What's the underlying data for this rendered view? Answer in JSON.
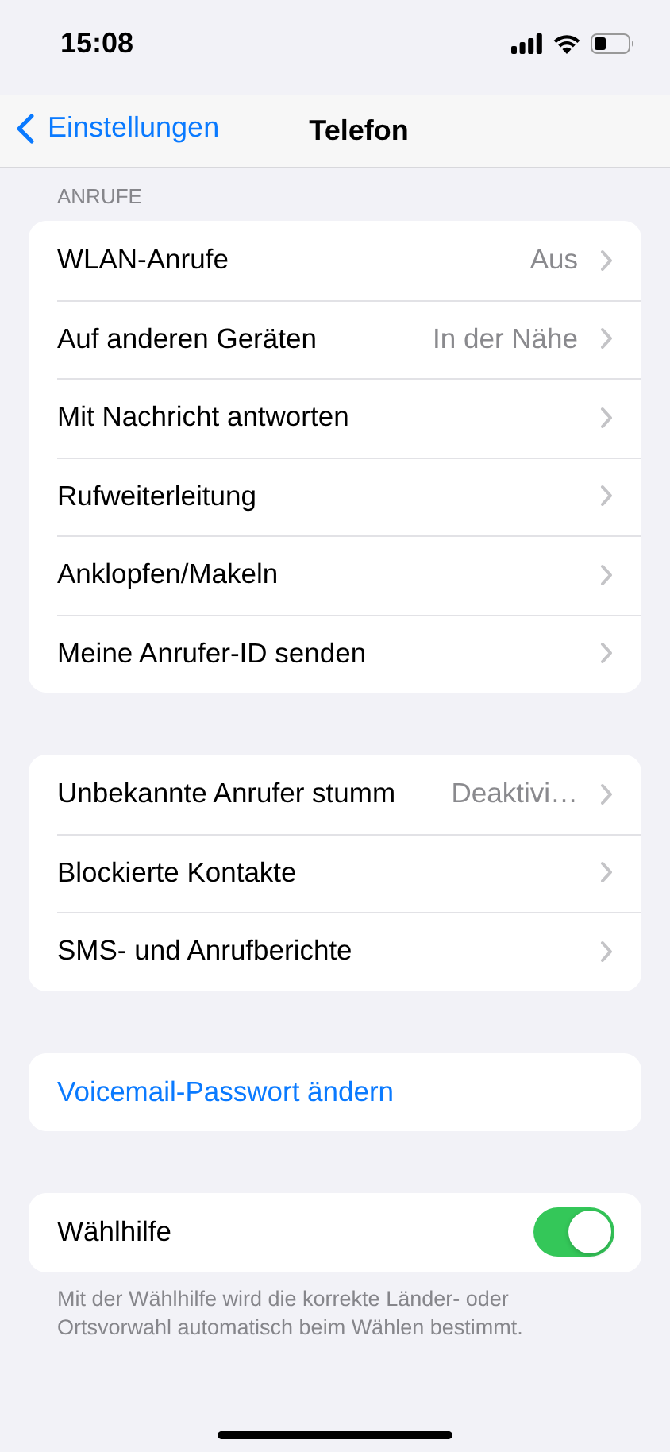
{
  "status_bar": {
    "time": "15:08"
  },
  "nav": {
    "back": "Einstellungen",
    "title": "Telefon"
  },
  "groups": [
    {
      "header": "ANRUFE",
      "rows": [
        {
          "kind": "link",
          "label": "WLAN-Anrufe",
          "value": "Aus"
        },
        {
          "kind": "link",
          "label": "Auf anderen Geräten",
          "value": "In der Nähe"
        },
        {
          "kind": "link",
          "label": "Mit Nachricht antworten"
        },
        {
          "kind": "link",
          "label": "Rufweiterleitung"
        },
        {
          "kind": "link",
          "label": "Anklopfen/Makeln"
        },
        {
          "kind": "link",
          "label": "Meine Anrufer-ID senden"
        }
      ]
    },
    {
      "rows": [
        {
          "kind": "link",
          "label": "Unbekannte Anrufer stumm",
          "value": "Deaktivi…"
        },
        {
          "kind": "link",
          "label": "Blockierte Kontakte"
        },
        {
          "kind": "link",
          "label": "SMS- und Anrufberichte"
        }
      ]
    },
    {
      "rows": [
        {
          "kind": "action",
          "label": "Voicemail-Passwort ändern"
        }
      ]
    },
    {
      "rows": [
        {
          "kind": "toggle",
          "label": "Wählhilfe",
          "on": true
        }
      ],
      "footer": "Mit der Wählhilfe wird die korrekte Länder- oder Ortsvorwahl automatisch beim Wählen bestimmt."
    }
  ]
}
